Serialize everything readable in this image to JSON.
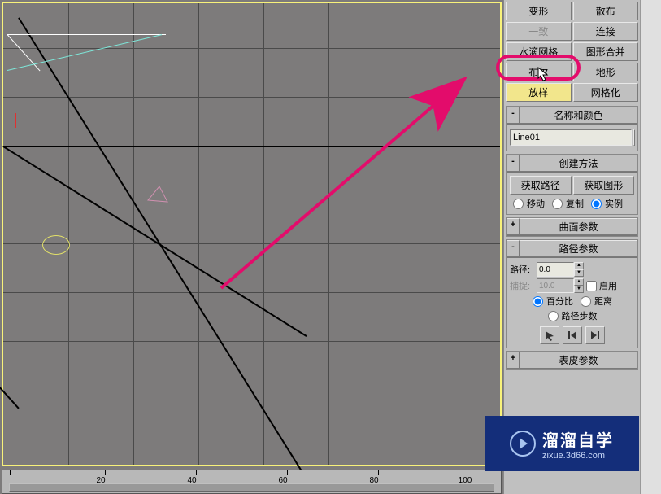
{
  "topButtons": {
    "r1a": "变形",
    "r1b": "散布",
    "r2a": "一致",
    "r2b": "连接",
    "r3a": "水滴网格",
    "r3b": "图形合并",
    "r4a": "布尔",
    "r4b": "地形",
    "r5a": "放样",
    "r5b": "网格化"
  },
  "nameColor": {
    "title": "名称和颜色",
    "value": "Line01",
    "swatch": "#7de8d0"
  },
  "createMethod": {
    "title": "创建方法",
    "getPath": "获取路径",
    "getShape": "获取图形",
    "opt1": "移动",
    "opt2": "复制",
    "opt3": "实例"
  },
  "surfaceParams": {
    "title": "曲面参数"
  },
  "pathParams": {
    "title": "路径参数",
    "pathLabel": "路径:",
    "pathValue": "0.0",
    "snapLabel": "捕捉:",
    "snapValue": "10.0",
    "enableLabel": "启用",
    "pctLabel": "百分比",
    "distLabel": "距离",
    "stepsLabel": "路径步数"
  },
  "skinParams": {
    "title": "表皮参数"
  },
  "timeline": {
    "ticks": [
      {
        "pos": 0,
        "label": ""
      },
      {
        "pos": 20,
        "label": "20"
      },
      {
        "pos": 40,
        "label": "40"
      },
      {
        "pos": 60,
        "label": "60"
      },
      {
        "pos": 80,
        "label": "80"
      },
      {
        "pos": 100,
        "label": "100"
      }
    ]
  },
  "watermark": {
    "big": "溜溜自学",
    "small": "zixue.3d66.com"
  }
}
